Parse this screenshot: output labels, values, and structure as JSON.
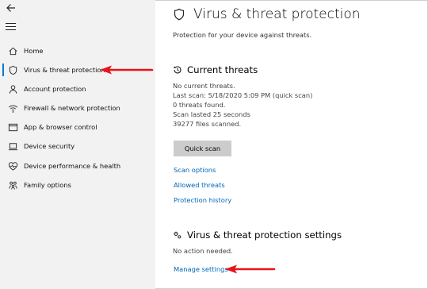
{
  "sidebar": {
    "items": [
      {
        "label": "Home",
        "icon": "home-icon"
      },
      {
        "label": "Virus & threat protection",
        "icon": "shield-icon",
        "selected": true
      },
      {
        "label": "Account protection",
        "icon": "person-icon"
      },
      {
        "label": "Firewall & network protection",
        "icon": "wifi-icon"
      },
      {
        "label": "App & browser control",
        "icon": "browser-window-icon"
      },
      {
        "label": "Device security",
        "icon": "laptop-icon"
      },
      {
        "label": "Device performance & health",
        "icon": "heart-icon"
      },
      {
        "label": "Family options",
        "icon": "family-icon"
      }
    ]
  },
  "main": {
    "title": "Virus & threat protection",
    "subtitle": "Protection for your device against threats.",
    "current_threats": {
      "heading": "Current threats",
      "lines": [
        "No current threats.",
        "Last scan: 5/18/2020 5:09 PM (quick scan)",
        "0 threats found.",
        "Scan lasted 25 seconds",
        "39277 files scanned."
      ],
      "quick_scan_label": "Quick scan",
      "links": [
        "Scan options",
        "Allowed threats",
        "Protection history"
      ]
    },
    "settings": {
      "heading": "Virus & threat protection settings",
      "status": "No action needed.",
      "manage_link": "Manage settings"
    }
  },
  "colors": {
    "accent": "#0078d4",
    "link": "#0067b8",
    "annotation_arrow": "#e8141b"
  }
}
